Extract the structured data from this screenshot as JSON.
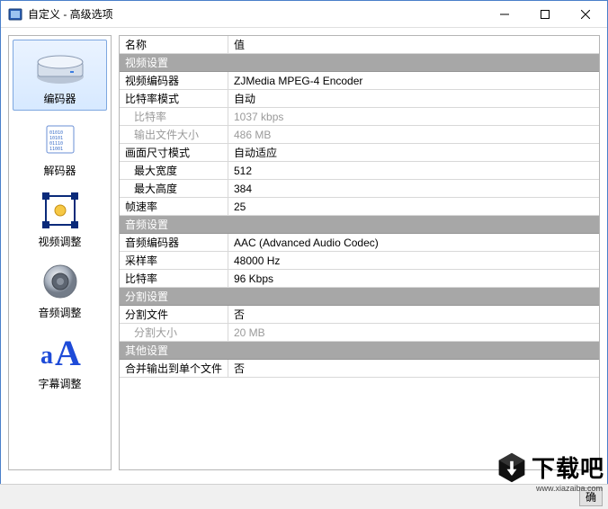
{
  "window": {
    "title": "自定义 - 高级选项"
  },
  "sidebar": {
    "items": [
      {
        "label": "编码器"
      },
      {
        "label": "解码器"
      },
      {
        "label": "视频调整"
      },
      {
        "label": "音频调整"
      },
      {
        "label": "字幕调整"
      }
    ]
  },
  "table": {
    "header_name": "名称",
    "header_value": "值",
    "sections": [
      {
        "title": "视频设置",
        "rows": [
          {
            "name": "视频编码器",
            "value": "ZJMedia MPEG-4 Encoder",
            "indent": false,
            "disabled": false
          },
          {
            "name": "比特率模式",
            "value": "自动",
            "indent": false,
            "disabled": false
          },
          {
            "name": "比特率",
            "value": "1037 kbps",
            "indent": true,
            "disabled": true
          },
          {
            "name": "输出文件大小",
            "value": "486 MB",
            "indent": true,
            "disabled": true
          },
          {
            "name": "画面尺寸模式",
            "value": "自动适应",
            "indent": false,
            "disabled": false
          },
          {
            "name": "最大宽度",
            "value": "512",
            "indent": true,
            "disabled": false
          },
          {
            "name": "最大高度",
            "value": "384",
            "indent": true,
            "disabled": false
          },
          {
            "name": "帧速率",
            "value": "25",
            "indent": false,
            "disabled": false
          }
        ]
      },
      {
        "title": "音频设置",
        "rows": [
          {
            "name": "音频编码器",
            "value": "AAC (Advanced Audio Codec)",
            "indent": false,
            "disabled": false
          },
          {
            "name": "采样率",
            "value": "48000 Hz",
            "indent": false,
            "disabled": false
          },
          {
            "name": "比特率",
            "value": "96 Kbps",
            "indent": false,
            "disabled": false
          }
        ]
      },
      {
        "title": "分割设置",
        "rows": [
          {
            "name": "分割文件",
            "value": "否",
            "indent": false,
            "disabled": false
          },
          {
            "name": "分割大小",
            "value": "20 MB",
            "indent": true,
            "disabled": true
          }
        ]
      },
      {
        "title": "其他设置",
        "rows": [
          {
            "name": "合并输出到单个文件",
            "value": "否",
            "indent": false,
            "disabled": false
          }
        ]
      }
    ]
  },
  "buttons": {
    "ok_partial": "确"
  },
  "watermark": {
    "text": "下载吧",
    "url": "www.xiazaiba.com"
  }
}
